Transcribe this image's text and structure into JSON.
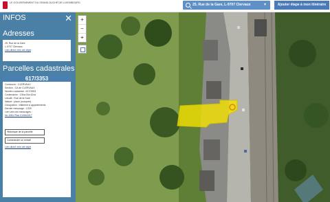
{
  "header": {
    "logo_text": "LE GOUVERNEMENT DU GRAND-DUCHÉ DE LUXEMBOURG",
    "search_value": "25, Rue de la Gare, L-9707 Clervaux",
    "add_button": "Ajouter étape à mon itinéraire"
  },
  "panel": {
    "title": "INFOS",
    "address_title": "Adresses",
    "address_line1": "25, Rue de la Gare",
    "address_line2": "L-9707 Clervaux",
    "address_link": "Lien direct vers cet objet",
    "parcels_title": "Parcelles cadastrales",
    "parcel_number": "617/3353",
    "parcel_fields": [
      "Commune : CLERVAUX",
      "Section : CA de CLERVAUX",
      "Numéro cadastral : 617/3353",
      "Contenance : 13ha 00a 42ca",
      "Lieudit : Rue de la Gare",
      "Nature : place (occupée)",
      "Occupation : bâtiment à appartements",
      "Dernier mesurage : 1329",
      "Lien vers les mesurages :"
    ],
    "measure_link": "No 1081 Plan 01/06/2017",
    "history_button": "Historique de la parcelle",
    "order_button": "Commander un extrait",
    "parcel_link": "Lien direct vers cet objet"
  },
  "map_controls": {
    "zoom_in": "+",
    "zoom_out": "−",
    "compass": "⌖"
  },
  "colors": {
    "panel_bg": "#4a80b0",
    "header_btn": "#4a7ab8",
    "parcel_highlight": "#f5e400"
  }
}
